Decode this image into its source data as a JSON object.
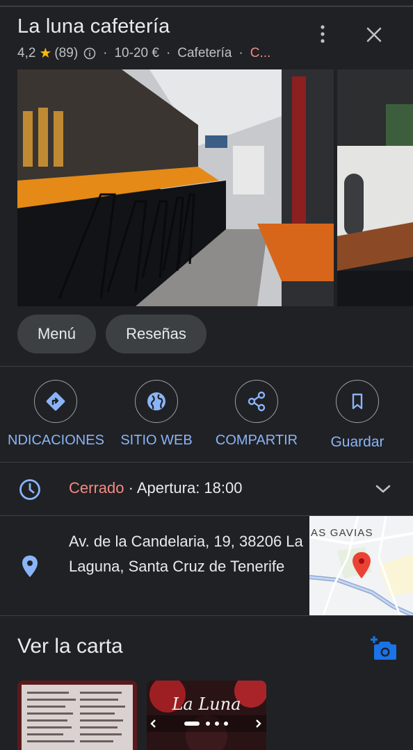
{
  "header": {
    "title": "La luna cafetería",
    "rating": "4,2",
    "review_count": "(89)",
    "price": "10-20 €",
    "category": "Cafetería",
    "more_truncated": "C..."
  },
  "chips": [
    {
      "label": "Menú"
    },
    {
      "label": "Reseñas"
    }
  ],
  "actions": [
    {
      "label": "NDICACIONES",
      "icon": "directions-icon"
    },
    {
      "label": "SITIO WEB",
      "icon": "globe-icon"
    },
    {
      "label": "COMPARTIR",
      "icon": "share-icon"
    },
    {
      "label": "Guardar",
      "icon": "bookmark-icon"
    }
  ],
  "hours": {
    "status": "Cerrado",
    "separator": " · ",
    "opening": "Apertura: 18:00"
  },
  "address": {
    "text": "Av. de la Candelaria, 19, 38206 La Laguna, Santa Cruz de Tenerife",
    "map_label": "AS GAVIAS"
  },
  "menu_section": {
    "title": "Ver la carta",
    "thumb_text": "La Luna"
  },
  "colors": {
    "background": "#202124",
    "accent": "#8ab4f8",
    "closed": "#f28b82",
    "star": "#fbbc04",
    "pin": "#ea4335"
  }
}
